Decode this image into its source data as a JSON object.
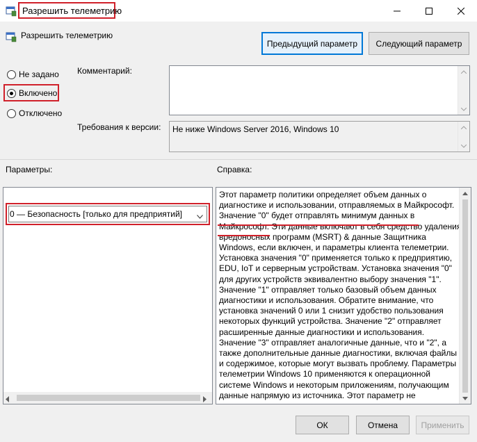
{
  "window": {
    "title": "Разрешить телеметрию"
  },
  "header": {
    "title": "Разрешить телеметрию",
    "prev_button": "Предыдущий параметр",
    "next_button": "Следующий параметр"
  },
  "state": {
    "options": [
      {
        "label": "Не задано",
        "selected": false
      },
      {
        "label": "Включено",
        "selected": true
      },
      {
        "label": "Отключено",
        "selected": false
      }
    ]
  },
  "comment": {
    "label": "Комментарий:",
    "value": ""
  },
  "requirements": {
    "label": "Требования к версии:",
    "value": "Не ниже Windows Server 2016, Windows 10"
  },
  "params": {
    "label": "Параметры:",
    "dropdown_value": "0 — Безопасность [только для предприятий]"
  },
  "help": {
    "label": "Справка:",
    "lines": [
      "Этот параметр политики определяет объем данных о",
      "диагностике и использовании, отправляемых в Майкрософт.",
      "Значение \"0\" будет отправлять минимум данных в",
      "Майкрософт. Эти данные включают в себя средство удаления",
      "вредоносных программ (MSRT) & данные Защитника",
      "Windows, если включен, и параметры клиента телеметрии.",
      "Установка значения \"0\" применяется только к предприятию,",
      "EDU, IoT и серверным устройствам. Установка значения \"0\"",
      "для других устройств эквивалентно выбору значения \"1\".",
      "Значение \"1\" отправляет только базовый объем данных",
      "диагностики и использования. Обратите внимание, что",
      "установка значений 0 или 1 снизит удобство пользования",
      "некоторых функций устройства. Значение \"2\" отправляет",
      "расширенные данные диагностики и использования.",
      "Значение \"3\" отправляет аналогичные данные, что и \"2\", а",
      "также дополнительные данные диагностики, включая файлы",
      "и содержимое, которые могут вызвать проблему. Параметры",
      "телеметрии Windows 10 применяются к операционной",
      "системе Windows и некоторым приложениям, получающим",
      "данные напрямую из источника. Этот параметр не"
    ]
  },
  "footer": {
    "ok": "ОК",
    "cancel": "Отмена",
    "apply": "Применить"
  },
  "colors": {
    "highlight": "#d0202a",
    "focus": "#0078d7"
  },
  "icons": [
    "policy-icon",
    "minimize-icon",
    "maximize-icon",
    "close-icon",
    "chevron-down-icon"
  ]
}
